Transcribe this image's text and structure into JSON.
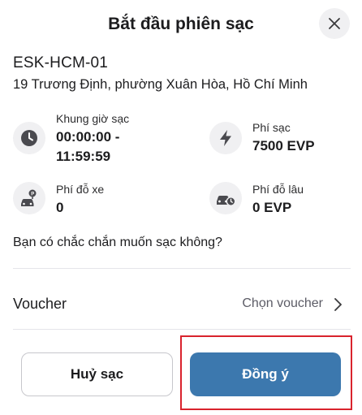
{
  "dialog": {
    "title": "Bắt đầu phiên sạc",
    "close_icon": "close-icon"
  },
  "station": {
    "code": "ESK-HCM-01",
    "address": "19 Trương Định, phường Xuân Hòa, Hồ Chí Minh"
  },
  "info": {
    "charging_window": {
      "icon": "clock-icon",
      "label": "Khung giờ sạc",
      "value_line1": "00:00:00 -",
      "value_line2": "11:59:59"
    },
    "charging_fee": {
      "icon": "lightning-icon",
      "label": "Phí sạc",
      "value": "7500 EVP"
    },
    "parking_fee": {
      "icon": "parking-car-icon",
      "label": "Phí đỗ xe",
      "value": "0"
    },
    "overtime_fee": {
      "icon": "car-clock-icon",
      "label": "Phí đỗ lâu",
      "value": "0 EVP"
    }
  },
  "question": "Bạn có chắc chắn muốn sạc không?",
  "voucher": {
    "label": "Voucher",
    "value": "Chọn voucher"
  },
  "actions": {
    "cancel_label": "Huỷ sạc",
    "confirm_label": "Đồng ý"
  },
  "colors": {
    "primary": "#3c78ae",
    "highlight": "#d9232d",
    "icon_bg": "#f0f0f2",
    "icon_fg": "#4a4a4f"
  }
}
